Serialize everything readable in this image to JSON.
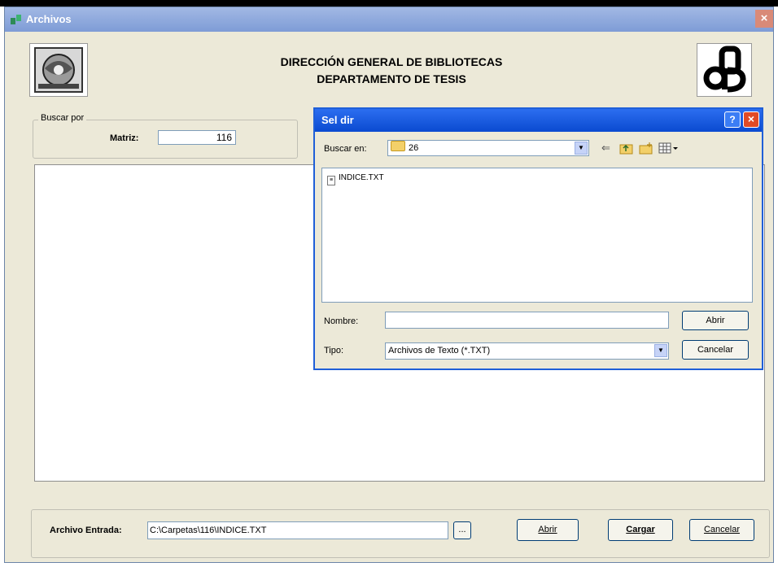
{
  "window": {
    "title": "Archivos",
    "close_glyph": "×"
  },
  "header": {
    "line1": "DIRECCIÓN GENERAL DE BIBLIOTECAS",
    "line2": "DEPARTAMENTO DE TESIS"
  },
  "search": {
    "group_label": "Buscar por",
    "matriz_label": "Matriz:",
    "matriz_value": "116"
  },
  "bottom": {
    "entrada_label": "Archivo Entrada:",
    "entrada_value": "C:\\Carpetas\\116\\INDICE.TXT",
    "browse_label": "...",
    "abrir_label": "Abrir",
    "cargar_label": "Cargar",
    "cancelar_label": "Cancelar"
  },
  "dialog": {
    "title": "Sel dir",
    "help_glyph": "?",
    "close_glyph": "×",
    "buscar_en_label": "Buscar en:",
    "buscar_en_value": "26",
    "files": [
      "INDICE.TXT"
    ],
    "nombre_label": "Nombre:",
    "nombre_value": "",
    "tipo_label": "Tipo:",
    "tipo_value": "Archivos de Texto (*.TXT)",
    "abrir_label": "Abrir",
    "cancelar_label": "Cancelar",
    "toolbar_icons": [
      "back-arrow-icon",
      "up-folder-icon",
      "new-folder-icon",
      "view-menu-icon"
    ]
  }
}
